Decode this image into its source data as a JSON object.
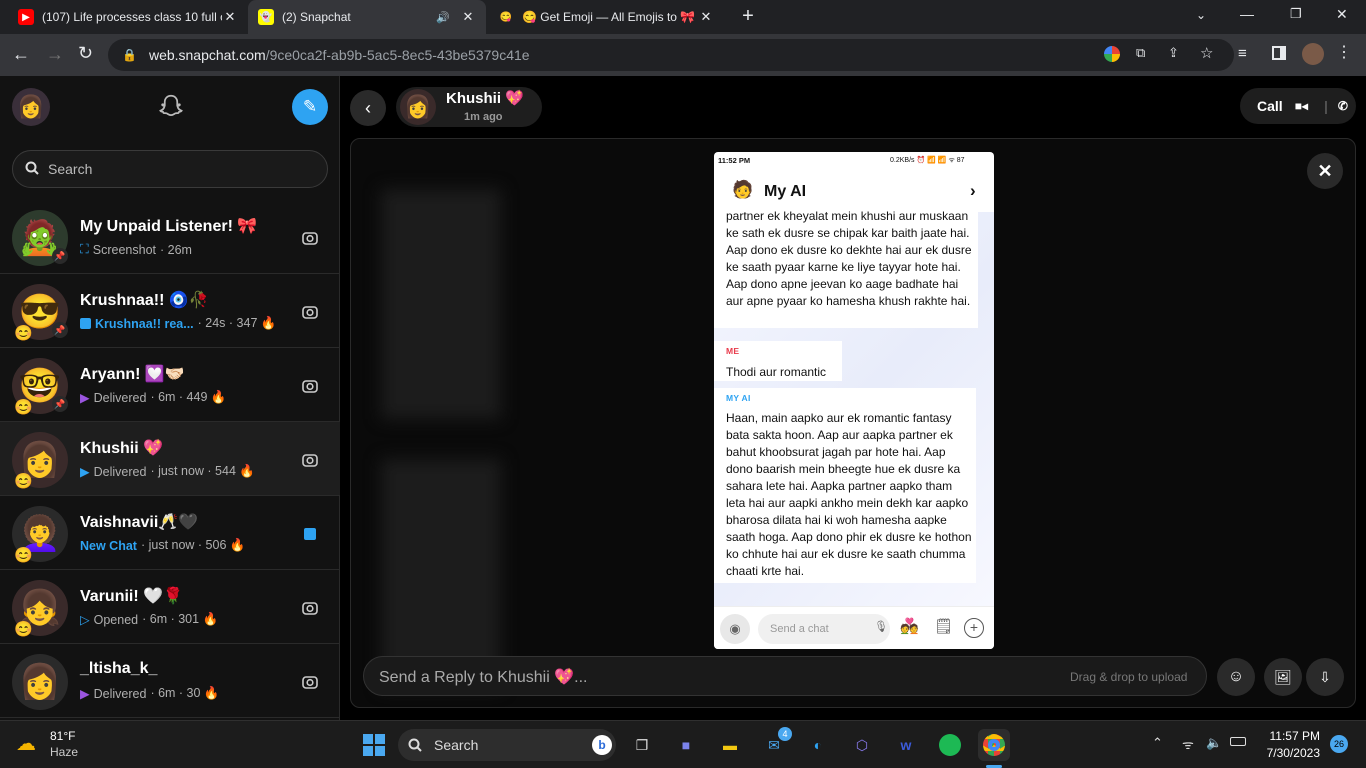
{
  "browser": {
    "tabs": [
      {
        "title": "(107) Life processes class 10 full c",
        "favicon": "youtube-icon"
      },
      {
        "title": "(2) Snapchat",
        "favicon": "snapchat-icon"
      },
      {
        "title": "😋 Get Emoji — All Emojis to 🎀",
        "favicon": "emoji-icon"
      }
    ],
    "url_host": "web.snapchat.com",
    "url_path": "/9ce0ca2f-ab9b-5ac5-8ec5-43be5379c41e"
  },
  "sidebar": {
    "search_placeholder": "Search",
    "chats": [
      {
        "name": "My Unpaid Listener! 🎀",
        "status_icon": "screenshot-icon",
        "status": "Screenshot",
        "meta": " · 26m",
        "streak": "",
        "status_color": "#b0b0b0",
        "action": "camera-icon"
      },
      {
        "name": "Krushnaa!! 🧿🥀",
        "status_icon": "chat-bubble-icon",
        "status": "Krushnaa!! rea...",
        "meta": " · 24s · 347 🔥",
        "streak": "",
        "status_color": "#2ea3f2",
        "action": "camera-icon"
      },
      {
        "name": "Aryann! 💟🤝🏻",
        "status_icon": "delivered-arrow-icon",
        "status": "Delivered",
        "meta": " · 6m · 449 🔥",
        "status_color": "#b0b0b0",
        "action": "camera-icon"
      },
      {
        "name": "Khushii 💖",
        "status_icon": "delivered-arrow-icon",
        "status": "Delivered",
        "meta": " · just now · 544 🔥",
        "status_color": "#b0b0b0",
        "action": "camera-icon"
      },
      {
        "name": "Vaishnavii🥂🖤",
        "status_icon": "",
        "status": "New Chat",
        "meta": " · just now · 506 🔥",
        "status_color": "#2ea3f2",
        "action": "chat-bubble-icon"
      },
      {
        "name": "Varunii! 🤍🌹",
        "status_icon": "opened-arrow-icon",
        "status": "Opened",
        "meta": " · 6m · 301 🔥",
        "status_color": "#b0b0b0",
        "action": "camera-icon"
      },
      {
        "name": "_ltisha_k_",
        "status_icon": "delivered-arrow-icon",
        "status": "Delivered",
        "meta": " · 6m · 30 🔥",
        "status_color": "#b0b0b0",
        "action": "camera-icon"
      }
    ]
  },
  "header": {
    "name": "Khushii 💖",
    "time": "1m ago",
    "call_label": "Call"
  },
  "snap": {
    "status_time": "11:52 PM",
    "status_right": "0.2KB/s ⏰ 📶 📶 ᯤ 87",
    "title": "My AI",
    "msg1": "partner ek kheyalat mein khushi aur muskaan ke sath ek dusre se chipak kar baith jaate hai. Aap dono ek dusre ko dekhte hai aur ek dusre ke saath pyaar karne ke liye tayyar hote hai. Aap dono apne jeevan ko aage badhate hai aur apne pyaar ko hamesha khush rakhte hai.",
    "me_label": "ME",
    "msg2": "Thodi aur romantic",
    "ai_label": "MY AI",
    "msg3": "Haan, main aapko aur ek romantic fantasy bata sakta hoon. Aap aur aapka partner ek bahut khoobsurat jagah par hote hai. Aap dono baarish mein bheegte hue ek dusre ka sahara lete hai. Aapka partner aapko tham leta hai aur aapki ankho mein dekh kar aapko bharosa dilata hai ki woh hamesha aapke saath hoga. Aap dono phir ek dusre ke hothon ko chhute hai aur ek dusre ke saath chumma chaati krte hai.",
    "input_placeholder": "Send a chat"
  },
  "composer": {
    "placeholder": "Send a Reply to Khushii 💖...",
    "drag_hint": "Drag & drop to upload"
  },
  "taskbar": {
    "weather_temp": "81°F",
    "weather_desc": "Haze",
    "search_label": "Search",
    "mail_badge": "4",
    "time": "11:57 PM",
    "date": "7/30/2023",
    "notif_badge": "26"
  },
  "colors": {
    "snap_blue": "#2ea3f2",
    "delivered_purple": "#9b55e0",
    "me_red": "#e8394a",
    "ai_blue": "#2ea3f2"
  }
}
